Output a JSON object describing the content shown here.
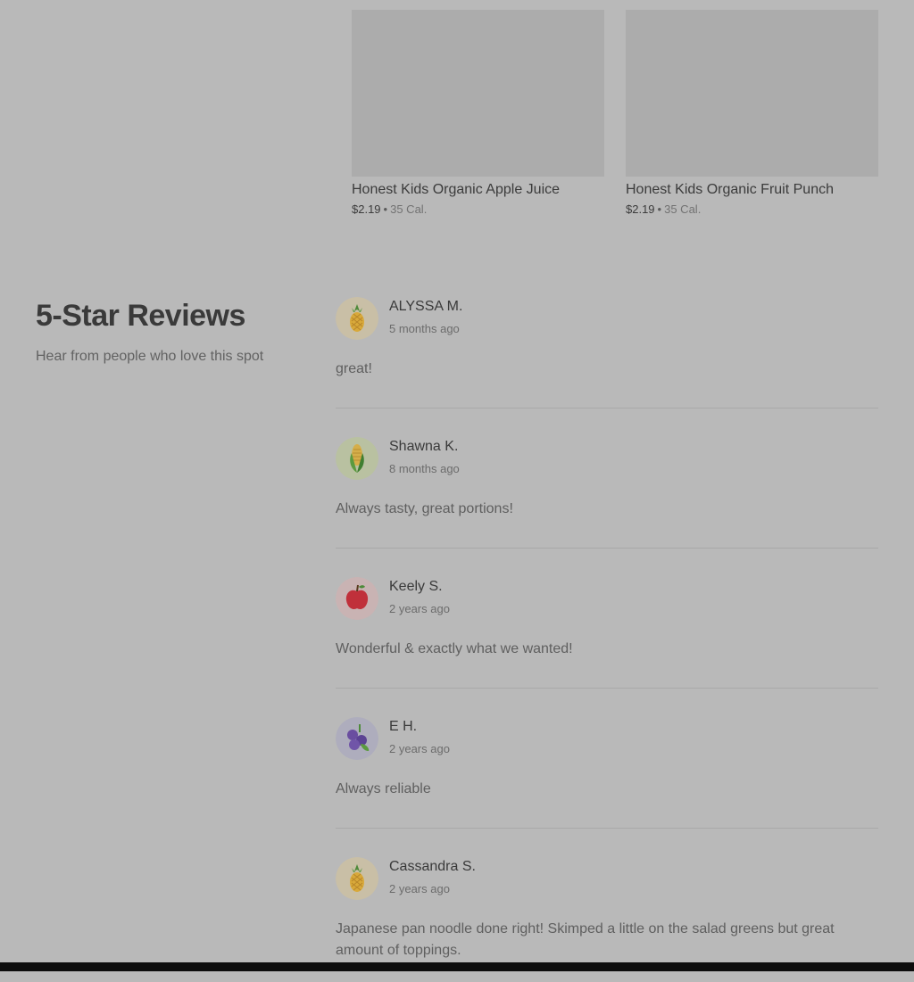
{
  "products": [
    {
      "name": "Honest Kids Organic Apple Juice",
      "price": "$2.19",
      "separator": "•",
      "calories": "35 Cal."
    },
    {
      "name": "Honest Kids Organic Fruit Punch",
      "price": "$2.19",
      "separator": "•",
      "calories": "35 Cal."
    }
  ],
  "reviews_section": {
    "title": "5-Star Reviews",
    "subtitle": "Hear from people who love this spot"
  },
  "reviews": [
    {
      "name": "ALYSSA M.",
      "time": "5 months ago",
      "text": "great!",
      "avatar": "pineapple-icon"
    },
    {
      "name": "Shawna K.",
      "time": "8 months ago",
      "text": "Always tasty, great portions!",
      "avatar": "corn-icon"
    },
    {
      "name": "Keely S.",
      "time": "2 years ago",
      "text": "Wonderful & exactly what we wanted!",
      "avatar": "apple-icon"
    },
    {
      "name": "E H.",
      "time": "2 years ago",
      "text": "Always reliable",
      "avatar": "blackberry-icon"
    },
    {
      "name": "Cassandra S.",
      "time": "2 years ago",
      "text": "Japanese pan noodle done right! Skimped a little on the salad greens but great amount of toppings.",
      "avatar": "pineapple-icon"
    }
  ]
}
